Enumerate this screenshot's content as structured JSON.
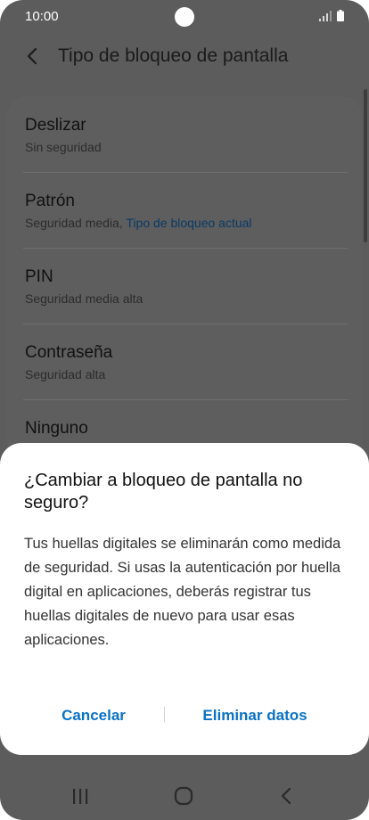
{
  "status_bar": {
    "time": "10:00",
    "icons": [
      "signal-icon",
      "battery-icon"
    ]
  },
  "header": {
    "back_icon": "back-arrow-icon",
    "title": "Tipo de bloqueo de pantalla"
  },
  "lock_options": [
    {
      "title": "Deslizar",
      "subtitle": "Sin seguridad"
    },
    {
      "title": "Patrón",
      "subtitle": "Seguridad media,",
      "subtitle_accent": "Tipo de bloqueo actual"
    },
    {
      "title": "PIN",
      "subtitle": "Seguridad media alta"
    },
    {
      "title": "Contraseña",
      "subtitle": "Seguridad alta"
    },
    {
      "title": "Ninguno"
    }
  ],
  "dialog": {
    "title": "¿Cambiar a bloqueo de pantalla no seguro?",
    "message": "Tus huellas digitales se eliminarán como medida de seguridad. Si usas la autenticación por huella digital en aplicaciones, deberás registrar tus huellas digitales de nuevo para usar esas aplicaciones.",
    "cancel_label": "Cancelar",
    "confirm_label": "Eliminar datos"
  },
  "nav_bar": {
    "icons": [
      "recent-apps-icon",
      "home-icon",
      "back-icon"
    ]
  },
  "colors": {
    "accent": "#0a72c3",
    "scrim_background": "#5c5c5c",
    "dialog_background": "#ffffff"
  }
}
